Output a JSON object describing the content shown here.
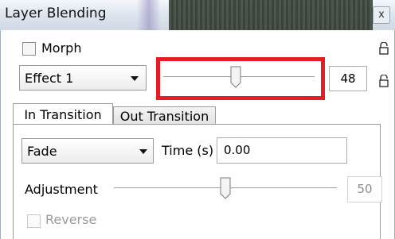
{
  "window": {
    "title": "Layer Blending",
    "close_glyph": "x"
  },
  "morph": {
    "label": "Morph",
    "checked": false
  },
  "effect": {
    "selected": "Effect 1",
    "slider_value": 48,
    "value_text": "48"
  },
  "tabs": [
    {
      "label": "In Transition",
      "active": true
    },
    {
      "label": "Out Transition",
      "active": false
    }
  ],
  "transition": {
    "type": "Fade",
    "time_label": "Time (s)",
    "time_value": "0.00",
    "adjustment_label": "Adjustment",
    "adjustment_value": 50,
    "adjustment_text": "50",
    "reverse_label": "Reverse",
    "reverse_checked": false,
    "reverse_enabled": false
  },
  "colors": {
    "highlight": "#e51c23",
    "titlebar": "#dfe6ef"
  },
  "icons": [
    "close-icon",
    "lock-icon",
    "chevron-down-icon",
    "slider-thumb-icon"
  ]
}
